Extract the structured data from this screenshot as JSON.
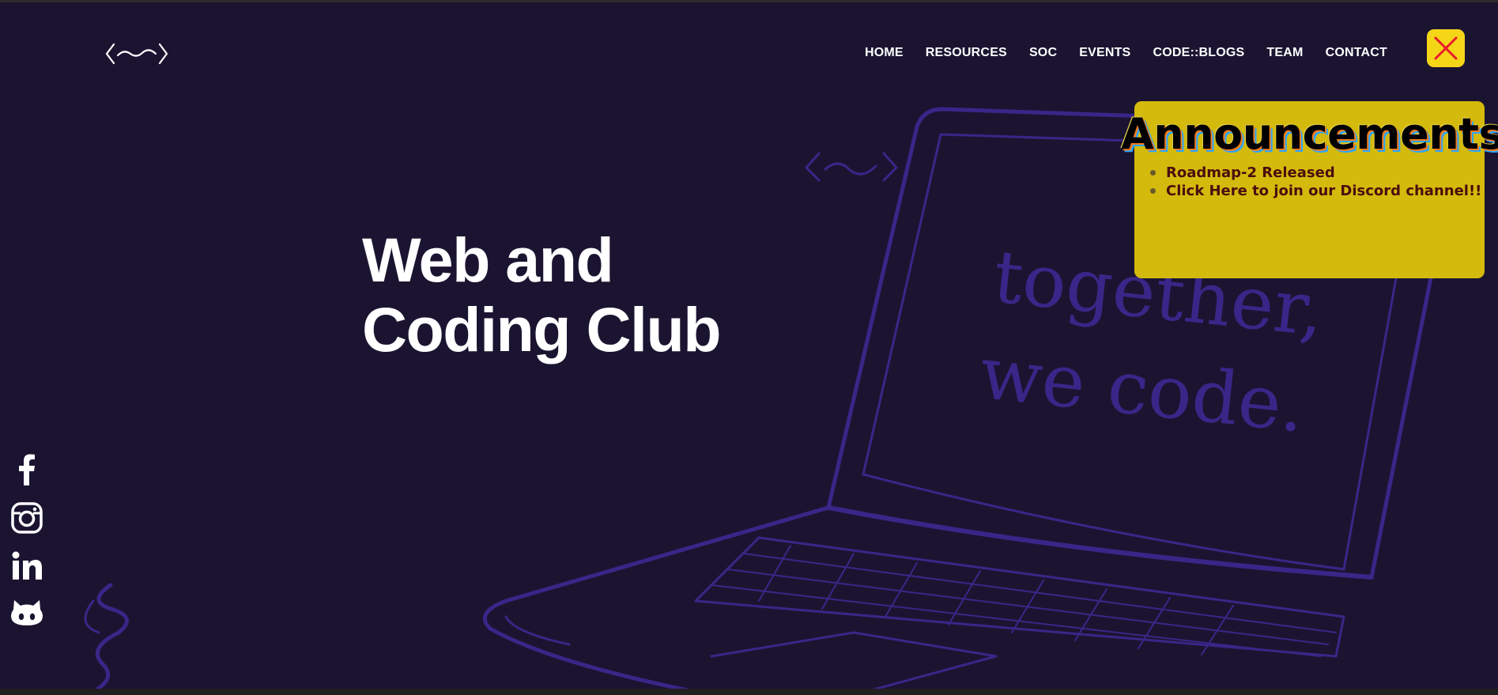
{
  "logo": {
    "icon": "wcc-logo-icon"
  },
  "nav": {
    "items": [
      {
        "label": "HOME"
      },
      {
        "label": "RESOURCES"
      },
      {
        "label": "SOC"
      },
      {
        "label": "EVENTS"
      },
      {
        "label": "CODE::BLOGS"
      },
      {
        "label": "TEAM"
      },
      {
        "label": "CONTACT"
      }
    ]
  },
  "hero": {
    "title_line1": "Web and",
    "title_line2": "Coding Club",
    "laptop_text_line1": "together,",
    "laptop_text_line2": "we code."
  },
  "announcements": {
    "title": "Announcements",
    "items": [
      {
        "label": "Roadmap-2 Released"
      },
      {
        "label": "Click Here to join our Discord channel!!"
      }
    ],
    "close_icon": "close-icon"
  },
  "socials": [
    {
      "icon": "facebook-icon"
    },
    {
      "icon": "instagram-icon"
    },
    {
      "icon": "linkedin-icon"
    },
    {
      "icon": "github-icon"
    }
  ],
  "colors": {
    "background": "#1b1431",
    "illustration": "#3a2688",
    "announce_bg": "#d3ba0c",
    "close_bg": "#f5d518",
    "close_x": "#e8192c",
    "text": "#ffffff"
  }
}
